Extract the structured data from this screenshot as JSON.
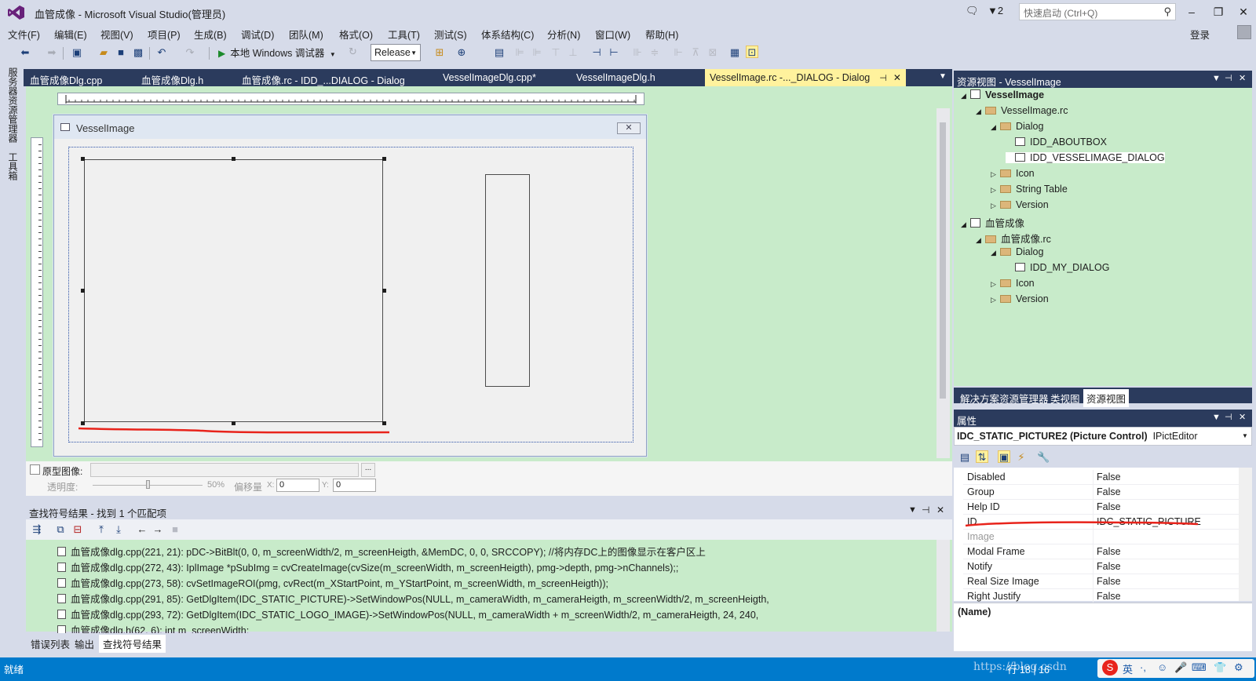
{
  "window": {
    "title": "血管成像 - Microsoft Visual Studio(管理员)",
    "notifications_count": "2",
    "quick_launch_placeholder": "快速启动 (Ctrl+Q)",
    "minimize": "–",
    "restore": "❐",
    "close": "✕"
  },
  "menu": {
    "items": [
      "文件(F)",
      "编辑(E)",
      "视图(V)",
      "项目(P)",
      "生成(B)",
      "调试(D)",
      "团队(M)",
      "格式(O)",
      "工具(T)",
      "测试(S)",
      "体系结构(C)",
      "分析(N)",
      "窗口(W)",
      "帮助(H)"
    ],
    "login": "登录"
  },
  "toolbar": {
    "debugger_label": "本地 Windows 调试器",
    "configuration": "Release"
  },
  "left_strip": {
    "tab1": "服务器资源管理器",
    "tab2": "工具箱"
  },
  "doc_tabs": [
    {
      "label": "血管成像Dlg.cpp"
    },
    {
      "label": "血管成像Dlg.h"
    },
    {
      "label": "血管成像.rc - IDD_...DIALOG - Dialog"
    },
    {
      "label": "VesselImageDlg.cpp*"
    },
    {
      "label": "VesselImageDlg.h"
    },
    {
      "label": "VesselImage.rc -..._DIALOG - Dialog",
      "active": true
    }
  ],
  "dialog": {
    "title": "VesselImage",
    "close_glyph": "✕"
  },
  "editor_bottom": {
    "prototype_label": "原型图像:",
    "opacity_label": "透明度:",
    "opacity_value": "50%",
    "offset_label": "偏移量",
    "x_label": "X:",
    "x_value": "0",
    "y_label": "Y:",
    "y_value": "0",
    "browse": "..."
  },
  "find_symbols": {
    "title": "查找符号结果 - 找到 1 个匹配项",
    "results": [
      "血管成像dlg.cpp(221, 21): pDC->BitBlt(0, 0, m_screenWidth/2, m_screenHeigth, &MemDC, 0, 0, SRCCOPY); //将内存DC上的图像显示在客户区上",
      "血管成像dlg.cpp(272, 43): IplImage *pSubImg = cvCreateImage(cvSize(m_screenWidth, m_screenHeigth), pmg->depth, pmg->nChannels);;",
      "血管成像dlg.cpp(273, 58): cvSetImageROI(pmg, cvRect(m_XStartPoint, m_YStartPoint, m_screenWidth, m_screenHeigth));",
      "血管成像dlg.cpp(291, 85): GetDlgItem(IDC_STATIC_PICTURE)->SetWindowPos(NULL, m_cameraWidth, m_cameraHeigth, m_screenWidth/2, m_screenHeigth,",
      "血管成像dlg.cpp(293, 72): GetDlgItem(IDC_STATIC_LOGO_IMAGE)->SetWindowPos(NULL, m_cameraWidth + m_screenWidth/2, m_cameraHeigth, 24, 240,",
      "血管成像dlg.h(62, 6): int m_screenWidth;"
    ]
  },
  "bottom_tabs": [
    "错误列表",
    "输出",
    "查找符号结果"
  ],
  "resource_view": {
    "title": "资源视图 - VesselImage",
    "tree": [
      {
        "label": "VesselImage",
        "level": 0,
        "kind": "project",
        "toggle": "◢",
        "bold": true
      },
      {
        "label": "VesselImage.rc",
        "level": 1,
        "kind": "folder",
        "toggle": "◢"
      },
      {
        "label": "Dialog",
        "level": 2,
        "kind": "folder",
        "toggle": "◢"
      },
      {
        "label": "IDD_ABOUTBOX",
        "level": 3,
        "kind": "dialog",
        "toggle": ""
      },
      {
        "label": "IDD_VESSELIMAGE_DIALOG",
        "level": 3,
        "kind": "dialog",
        "toggle": "",
        "selected": true
      },
      {
        "label": "Icon",
        "level": 2,
        "kind": "folder",
        "toggle": "▷"
      },
      {
        "label": "String Table",
        "level": 2,
        "kind": "folder",
        "toggle": "▷"
      },
      {
        "label": "Version",
        "level": 2,
        "kind": "folder",
        "toggle": "▷"
      },
      {
        "label": "血管成像",
        "level": 0,
        "kind": "project",
        "toggle": "◢"
      },
      {
        "label": "血管成像.rc",
        "level": 1,
        "kind": "folder",
        "toggle": "◢"
      },
      {
        "label": "Dialog",
        "level": 2,
        "kind": "folder",
        "toggle": "◢"
      },
      {
        "label": "IDD_MY_DIALOG",
        "level": 3,
        "kind": "dialog",
        "toggle": ""
      },
      {
        "label": "Icon",
        "level": 2,
        "kind": "folder",
        "toggle": "▷"
      },
      {
        "label": "Version",
        "level": 2,
        "kind": "folder",
        "toggle": "▷"
      }
    ],
    "tabs": [
      "解决方案资源管理器",
      "类视图",
      "资源视图"
    ]
  },
  "properties": {
    "title": "属性",
    "object": "IDC_STATIC_PICTURE2 (Picture Control)",
    "object_type": "IPictEditor",
    "rows": [
      {
        "name": "Disabled",
        "value": "False"
      },
      {
        "name": "Group",
        "value": "False"
      },
      {
        "name": "Help ID",
        "value": "False"
      },
      {
        "name": "ID",
        "value": "IDC_STATIC_PICTURE"
      },
      {
        "name": "Image",
        "value": "",
        "dim": true
      },
      {
        "name": "Modal Frame",
        "value": "False"
      },
      {
        "name": "Notify",
        "value": "False"
      },
      {
        "name": "Real Size Image",
        "value": "False"
      },
      {
        "name": "Right Justify",
        "value": "False"
      }
    ],
    "description_name": "(Name)"
  },
  "status": {
    "text": "就绪",
    "line_col": "行 18 | 16",
    "watermark": "https://blog.csdn",
    "ime": [
      "S",
      "英",
      "·,",
      "☺",
      "🎤",
      "⌨",
      "👕",
      "⚙"
    ]
  },
  "colors": {
    "editor_bg": "#c8ebca",
    "panel_header": "#2b3b5d",
    "chrome": "#d6dbe9",
    "statusbar": "#007acc",
    "active_tab": "#fff29d",
    "annotation_red": "#e8231b"
  }
}
